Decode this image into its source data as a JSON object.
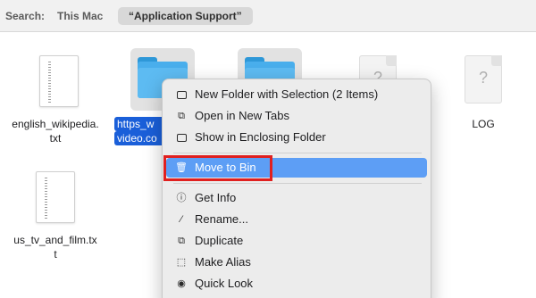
{
  "search_bar": {
    "label": "Search:",
    "scopes": [
      "This Mac",
      "“Application Support”"
    ],
    "selected_scope": "“Application Support”"
  },
  "files": [
    {
      "name_line1": "english_wikipedia.",
      "name_line2": "txt",
      "kind": "text-document"
    },
    {
      "name_line1": "https_w",
      "name_line2": "video.co",
      "kind": "folder",
      "selected": true
    },
    {
      "name_line1": "",
      "name_line2": "",
      "kind": "folder"
    },
    {
      "name_line1": "",
      "name_line2": "",
      "kind": "generic-document"
    },
    {
      "name_line1": "LOG",
      "name_line2": "",
      "kind": "generic-document"
    },
    {
      "name_line1": "us_tv_and_film.tx",
      "name_line2": "t",
      "kind": "text-document"
    }
  ],
  "context_menu": {
    "items": [
      {
        "label": "New Folder with Selection (2 Items)",
        "icon": "new-folder-icon"
      },
      {
        "label": "Open in New Tabs",
        "icon": "open-tabs-icon"
      },
      {
        "label": "Show in Enclosing Folder",
        "icon": "enclosing-folder-icon"
      },
      {
        "label": "Move to Bin",
        "icon": "trash-icon",
        "highlighted": true
      },
      {
        "label": "Get Info",
        "icon": "info-icon"
      },
      {
        "label": "Rename...",
        "icon": "pencil-icon"
      },
      {
        "label": "Duplicate",
        "icon": "duplicate-icon"
      },
      {
        "label": "Make Alias",
        "icon": "alias-icon"
      },
      {
        "label": "Quick Look",
        "icon": "eye-icon"
      }
    ]
  },
  "colors": {
    "selection": "#1a5fd9",
    "menu_highlight": "#5d9ef5",
    "annotation": "#e0201f",
    "folder": "#49aeec"
  }
}
